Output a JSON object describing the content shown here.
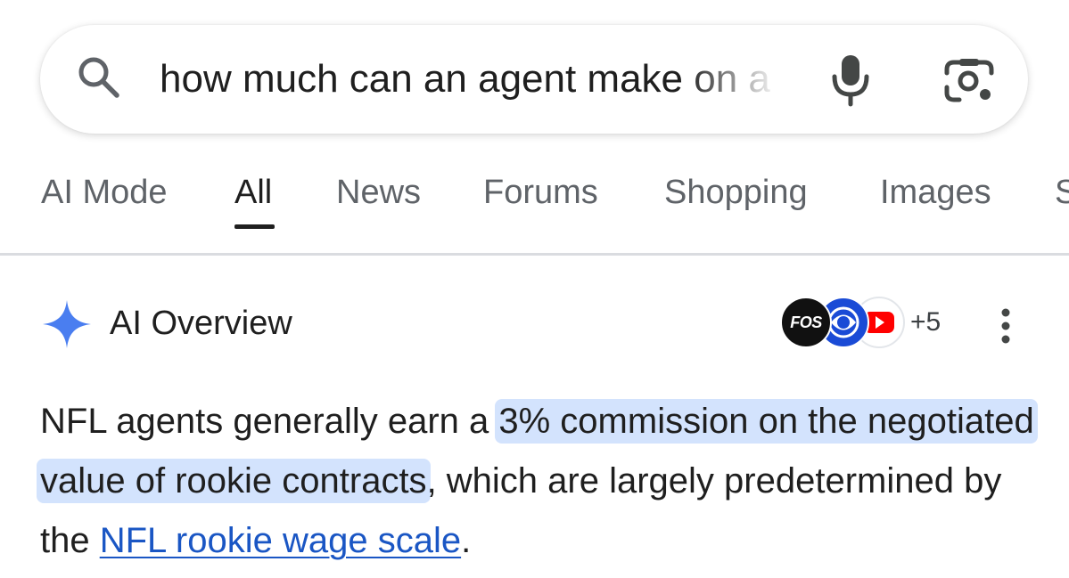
{
  "search": {
    "query": "how much can an agent make on a"
  },
  "tabs": [
    {
      "label": "AI Mode"
    },
    {
      "label": "All",
      "active": true
    },
    {
      "label": "News"
    },
    {
      "label": "Forums"
    },
    {
      "label": "Shopping"
    },
    {
      "label": "Images"
    },
    {
      "label": "S"
    }
  ],
  "ai_overview": {
    "title": "AI Overview",
    "sources": {
      "first_label": "FOS",
      "more": "+5"
    },
    "text": {
      "part1": "NFL agents generally earn a ",
      "highlight": "3% commission on the negotiated value of rookie contracts",
      "part2": ", which are largely predetermined by the ",
      "link": "NFL rookie wage scale",
      "part3": "."
    }
  },
  "colors": {
    "highlight": "#d3e3fd",
    "link": "#1a56c4",
    "spark": "#4a7ef0",
    "muted_tab": "#5f6368"
  },
  "icons": [
    "search-icon",
    "mic-icon",
    "lens-icon",
    "ai-spark-icon",
    "more-vert-icon"
  ]
}
